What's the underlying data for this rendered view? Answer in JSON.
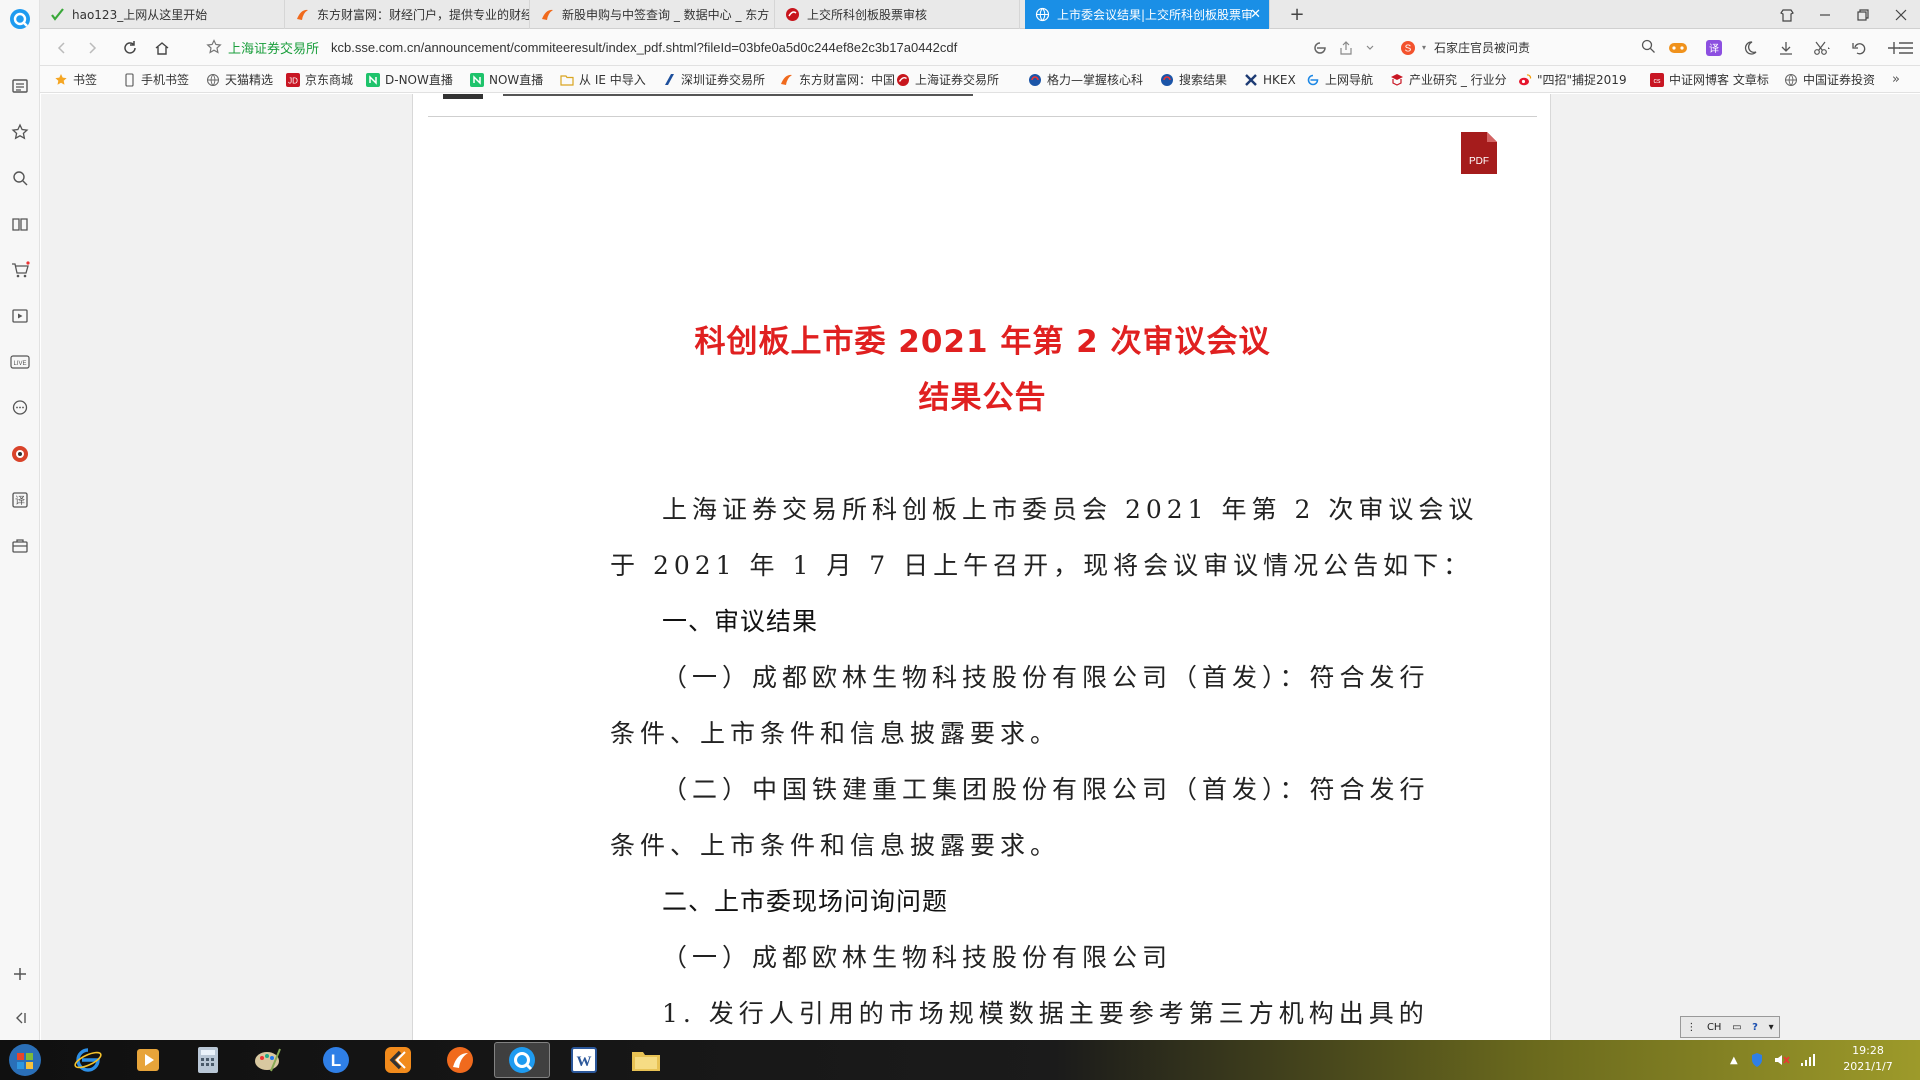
{
  "tabs": [
    {
      "label": "hao123_上网从这里开始",
      "icon": "hao123-icon"
    },
    {
      "label": "东方财富网：财经门户，提供专业的财经",
      "icon": "eastmoney-icon"
    },
    {
      "label": "新股申购与中签查询 _ 数据中心 _ 东方",
      "icon": "eastmoney-icon"
    },
    {
      "label": "上交所科创板股票审核",
      "icon": "sse-icon"
    },
    {
      "label": "上市委会议结果|上交所科创板股票审",
      "icon": "globe-icon",
      "active": true
    }
  ],
  "address": {
    "site_name": "上海证券交易所",
    "url": "kcb.sse.com.cn/announcement/commiteeresult/index_pdf.shtml?fileId=03bfe0a5d0c244ef8e2c3b17a0442cdf"
  },
  "search": {
    "text": "石家庄官员被问责"
  },
  "bookmarks": [
    {
      "label": "书签",
      "icon": "star-icon"
    },
    {
      "label": "手机书签",
      "icon": "phone-icon"
    },
    {
      "label": "天猫精选",
      "icon": "globe-icon"
    },
    {
      "label": "京东商城",
      "icon": "jd-icon"
    },
    {
      "label": "D-NOW直播",
      "icon": "now-icon"
    },
    {
      "label": "NOW直播",
      "icon": "now-icon"
    },
    {
      "label": "从 IE 中导入",
      "icon": "folder-icon"
    },
    {
      "label": "深圳证券交易所",
      "icon": "szse-icon"
    },
    {
      "label": "东方财富网：中国",
      "icon": "eastmoney-icon"
    },
    {
      "label": "上海证券交易所",
      "icon": "sse-icon"
    },
    {
      "label": "格力—掌握核心科",
      "icon": "gree-icon"
    },
    {
      "label": "搜索结果",
      "icon": "search-result-icon"
    },
    {
      "label": "HKEX",
      "icon": "hkex-icon"
    },
    {
      "label": "上网导航",
      "icon": "ie-icon"
    },
    {
      "label": "产业研究 _ 行业分",
      "icon": "research-icon"
    },
    {
      "label": "\"四招\"捕捉2019",
      "icon": "weibo-icon"
    },
    {
      "label": "中证网博客 文章标",
      "icon": "cs-icon"
    },
    {
      "label": "中国证券投资",
      "icon": "globe-icon"
    }
  ],
  "document": {
    "title_line1": "科创板上市委 2021 年第 2 次审议会议",
    "title_line2": "结果公告",
    "para1_line1": "上海证券交易所科创板上市委员会 2021 年第 2 次审议会议",
    "para1_line2": "于 2021 年 1 月 7 日上午召开，现将会议审议情况公告如下：",
    "section1": "一、审议结果",
    "item1_line1": "（一）成都欧林生物科技股份有限公司（首发）：符合发行",
    "item1_line2": "条件、上市条件和信息披露要求。",
    "item2_line1": "（二）中国铁建重工集团股份有限公司（首发）：符合发行",
    "item2_line2": "条件、上市条件和信息披露要求。",
    "section2": "二、上市委现场问询问题",
    "sub1": "（一）成都欧林生物科技股份有限公司",
    "point1": "1. 发行人引用的市场规模数据主要参考第三方机构出具的",
    "pdf_label": "PDF"
  },
  "ime": {
    "label": "CH"
  },
  "clock": {
    "time": "19:28",
    "date": "2021/1/7"
  },
  "colors": {
    "accent": "#1a8fe6",
    "title_red": "#e02020",
    "site_green": "#1a9e3c"
  }
}
